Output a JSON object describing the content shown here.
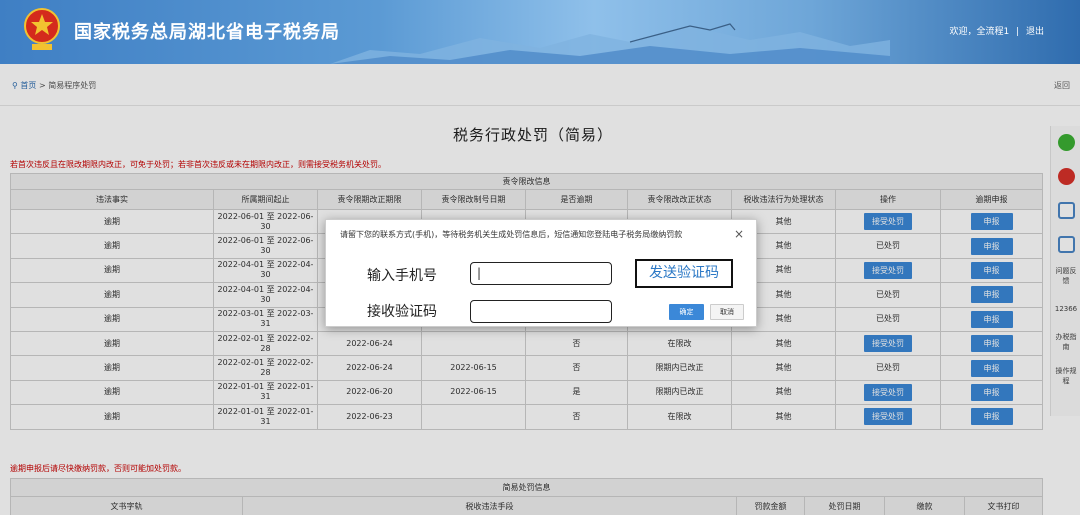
{
  "header": {
    "site_title": "国家税务总局湖北省电子税务局",
    "welcome": "欢迎，全流程1",
    "separator": "|",
    "logout": "退出"
  },
  "breadcrumb": {
    "home": "首页",
    "separator": ">",
    "current": "简易程序处罚",
    "back": "返回"
  },
  "page": {
    "title": "税务行政处罚（简易）",
    "notice_top": "若首次违反且在限改期限内改正，可免于处罚；若非首次违反或未在期限内改正，则需接受税务机关处罚。",
    "notice_bottom": "逾期申报后请尽快缴纳罚款，否则可能加处罚款。"
  },
  "table1": {
    "caption": "责令限改信息",
    "headers": [
      "违法事实",
      "所属期间起止",
      "责令限期改正期限",
      "责令限改制号日期",
      "是否逾期",
      "责令限改改正状态",
      "税收违法行为处理状态",
      "操作",
      "逾期申报"
    ],
    "rows": [
      {
        "fact": "逾期",
        "period": "2022-06-01 至 2022-06-30",
        "deadline": "",
        "date": "",
        "overdue": "",
        "status": "",
        "handling": "其他",
        "action": "接受处罚",
        "action_type": "button",
        "report": "申报"
      },
      {
        "fact": "逾期",
        "period": "2022-06-01 至 2022-06-30",
        "deadline": "",
        "date": "",
        "overdue": "",
        "status": "",
        "handling": "其他",
        "action": "已处罚",
        "action_type": "text",
        "report": "申报"
      },
      {
        "fact": "逾期",
        "period": "2022-04-01 至 2022-04-30",
        "deadline": "",
        "date": "",
        "overdue": "",
        "status": "",
        "handling": "其他",
        "action": "接受处罚",
        "action_type": "button",
        "report": "申报"
      },
      {
        "fact": "逾期",
        "period": "2022-04-01 至 2022-04-30",
        "deadline": "",
        "date": "",
        "overdue": "",
        "status": "",
        "handling": "其他",
        "action": "已处罚",
        "action_type": "text",
        "report": "申报"
      },
      {
        "fact": "逾期",
        "period": "2022-03-01 至 2022-03-31",
        "deadline": "",
        "date": "",
        "overdue": "",
        "status": "",
        "handling": "其他",
        "action": "已处罚",
        "action_type": "text",
        "report": "申报"
      },
      {
        "fact": "逾期",
        "period": "2022-02-01 至 2022-02-28",
        "deadline": "2022-06-24",
        "date": "",
        "overdue": "否",
        "status": "在限改",
        "handling": "其他",
        "action": "接受处罚",
        "action_type": "button",
        "report": "申报"
      },
      {
        "fact": "逾期",
        "period": "2022-02-01 至 2022-02-28",
        "deadline": "2022-06-24",
        "date": "2022-06-15",
        "overdue": "否",
        "status": "限期内已改正",
        "handling": "其他",
        "action": "已处罚",
        "action_type": "text",
        "report": "申报"
      },
      {
        "fact": "逾期",
        "period": "2022-01-01 至 2022-01-31",
        "deadline": "2022-06-20",
        "date": "2022-06-15",
        "overdue": "是",
        "status": "限期内已改正",
        "handling": "其他",
        "action": "接受处罚",
        "action_type": "button",
        "report": "申报"
      },
      {
        "fact": "逾期",
        "period": "2022-01-01 至 2022-01-31",
        "deadline": "2022-06-23",
        "date": "",
        "overdue": "否",
        "status": "在限改",
        "handling": "其他",
        "action": "接受处罚",
        "action_type": "button",
        "report": "申报"
      }
    ]
  },
  "table2": {
    "caption": "简易处罚信息",
    "headers": [
      "文书字轨",
      "税收违法手段",
      "罚款金额",
      "处罚日期",
      "缴款",
      "文书打印"
    ]
  },
  "sidebar": {
    "feedback": "问题反馈",
    "hotline": "12366",
    "guide": "办税指南",
    "manual": "操作规程"
  },
  "modal": {
    "message": "请留下您的联系方式(手机)，等待税务机关生成处罚信息后，短信通知您登陆电子税务局缴纳罚款",
    "close": "×",
    "phone_label": "输入手机号",
    "phone_value": "|",
    "code_label": "接收验证码",
    "code_value": "",
    "send_code": "发送验证码",
    "confirm": "确定",
    "cancel": "取消"
  },
  "colors": {
    "header_blue": "#3f7fc4",
    "button_blue": "#3b88d8",
    "notice_red": "#cc0000"
  }
}
